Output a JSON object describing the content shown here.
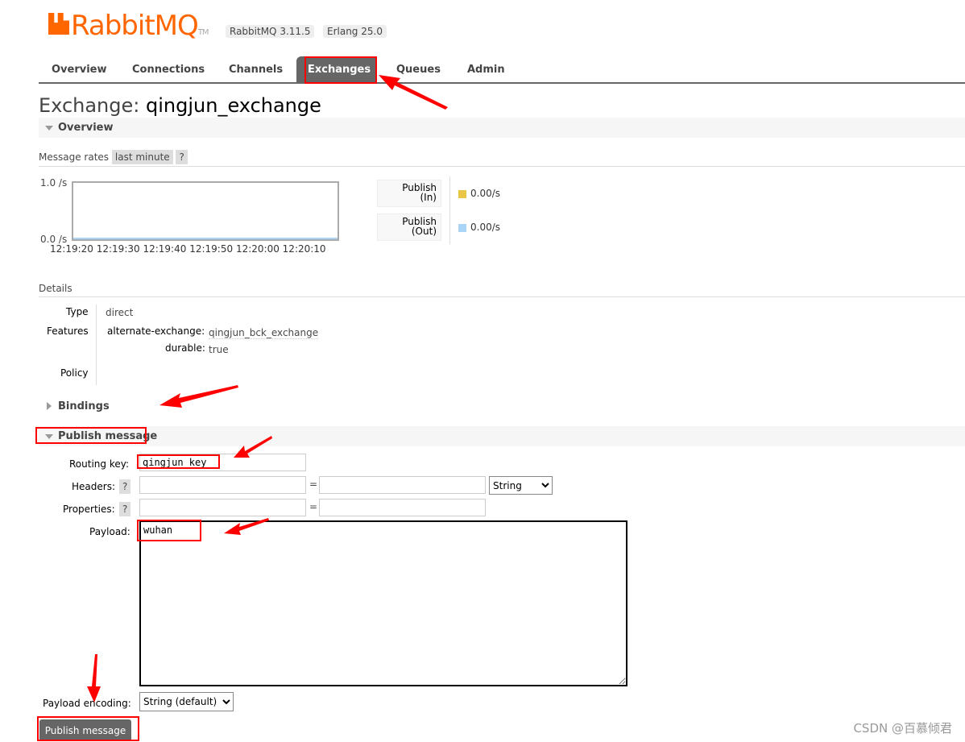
{
  "header": {
    "logo_text": "RabbitMQ",
    "logo_tm": "TM",
    "version_badge": "RabbitMQ 3.11.5",
    "erlang_badge": "Erlang 25.0"
  },
  "nav": {
    "tabs": [
      {
        "label": "Overview"
      },
      {
        "label": "Connections"
      },
      {
        "label": "Channels"
      },
      {
        "label": "Exchanges",
        "active": true
      },
      {
        "label": "Queues"
      },
      {
        "label": "Admin"
      }
    ]
  },
  "page": {
    "title_prefix": "Exchange:",
    "exchange_name": "qingjun_exchange"
  },
  "overview": {
    "heading": "Overview",
    "rates_label": "Message rates",
    "rates_period": "last minute",
    "help": "?",
    "chart": {
      "y_top": "1.0 /s",
      "y_bottom": "0.0 /s",
      "x_ticks": [
        "12:19:20",
        "12:19:30",
        "12:19:40",
        "12:19:50",
        "12:20:00",
        "12:20:10"
      ]
    },
    "legend": [
      {
        "label_1": "Publish",
        "label_2": "(In)",
        "value": "0.00/s",
        "color": "#ebc546"
      },
      {
        "label_1": "Publish",
        "label_2": "(Out)",
        "value": "0.00/s",
        "color": "#aad4f5"
      }
    ]
  },
  "details": {
    "heading": "Details",
    "type_label": "Type",
    "type_value": "direct",
    "features_label": "Features",
    "alt_label": "alternate-exchange:",
    "alt_value": "qingjun_bck_exchange",
    "durable_label": "durable:",
    "durable_value": "true",
    "policy_label": "Policy"
  },
  "bindings": {
    "heading": "Bindings"
  },
  "publish": {
    "heading": "Publish message",
    "routing_label": "Routing key:",
    "routing_value": "qingjun_key",
    "headers_label": "Headers:",
    "properties_label": "Properties:",
    "help": "?",
    "eq": "=",
    "header_type": "String",
    "payload_label": "Payload:",
    "payload_value": "wuhan",
    "encoding_label": "Payload encoding:",
    "encoding_value": "String (default)",
    "button": "Publish message"
  },
  "watermark": "CSDN @百慕倾君",
  "colors": {
    "brand": "#ff6600",
    "annotation": "#ff0000"
  }
}
